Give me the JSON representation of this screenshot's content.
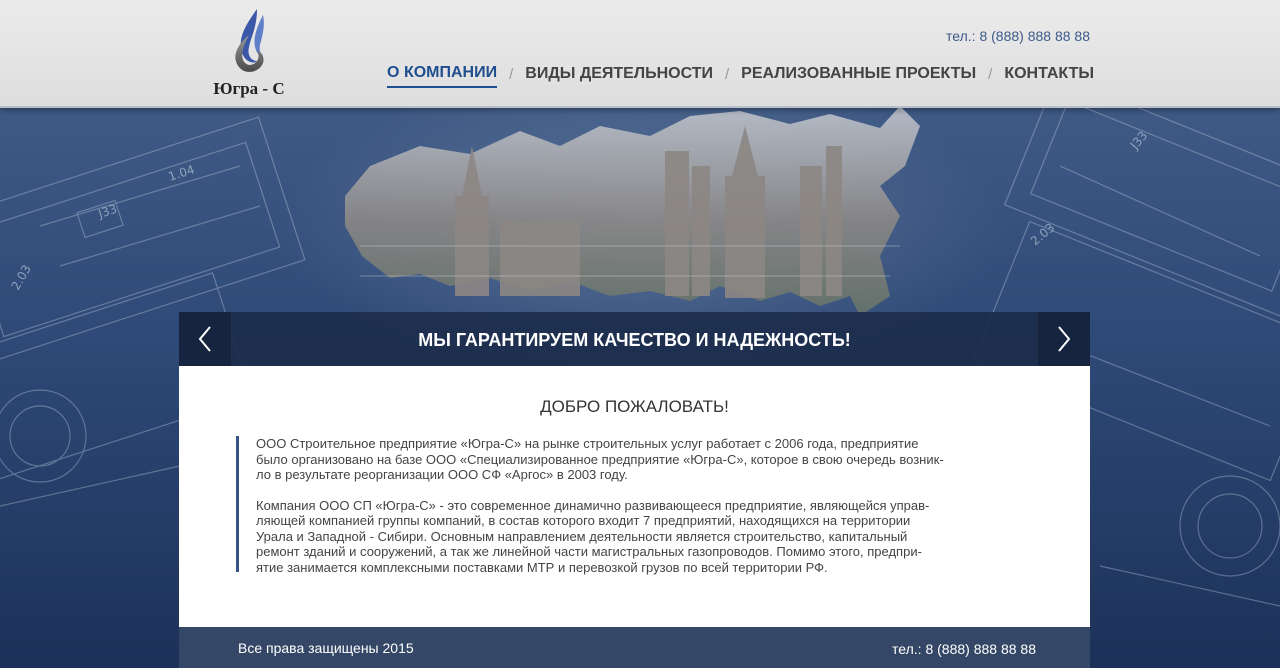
{
  "header": {
    "logo_text": "Югра - С",
    "phone": "тел.: 8 (888) 888 88 88"
  },
  "nav": [
    {
      "label": "О КОМПАНИИ",
      "active": true
    },
    {
      "label": "ВИДЫ ДЕЯТЕЛЬНОСТИ",
      "active": false
    },
    {
      "label": "РЕАЛИЗОВАННЫЕ ПРОЕКТЫ",
      "active": false
    },
    {
      "label": "КОНТАКТЫ",
      "active": false
    }
  ],
  "nav_separator": "/",
  "slider": {
    "caption": "МЫ ГАРАНТИРУЕМ КАЧЕСТВО И НАДЕЖНОСТЬ!",
    "prev_icon": "chevron-left-icon",
    "next_icon": "chevron-right-icon"
  },
  "hero_drawing_labels": [
    "1.04",
    "J33",
    "2.03",
    "J33",
    "2.03"
  ],
  "content": {
    "title": "ДОБРО ПОЖАЛОВАТЬ!",
    "paragraph1_lines": [
      "ООО Строительное предприятие «Югра-С»  на рынке строительных услуг работает с 2006 года, предприятие",
      "было организовано на базе ООО «Специализированное предприятие «Югра-С», которое в свою очередь возник-",
      "ло в результате реорганизации  ООО СФ «Аргос» в 2003 году."
    ],
    "paragraph2_lines": [
      "Компания ООО СП «Югра-С» - это современное динамично развивающееся предприятие, являющейся управ-",
      "ляющей компанией группы компаний, в состав которого входит 7 предприятий, находящихся на территории",
      "Урала и Западной - Сибири. Основным направлением деятельности является строительство, капитальный",
      "ремонт зданий и сооружений, а так же  линейной части магистральных газопроводов. Помимо этого, предпри-",
      "ятие занимается комплексными поставками МТР  и перевозкой грузов по всей территории РФ."
    ]
  },
  "footer": {
    "copyright": "Все права защищены 2015",
    "phone": "тел.: 8 (888) 888 88 88"
  },
  "colors": {
    "accent": "#1f4f8f",
    "header_bg": "#e4e4e4",
    "hero_bg": "#2f4a78",
    "footer_bg": "#344766"
  }
}
